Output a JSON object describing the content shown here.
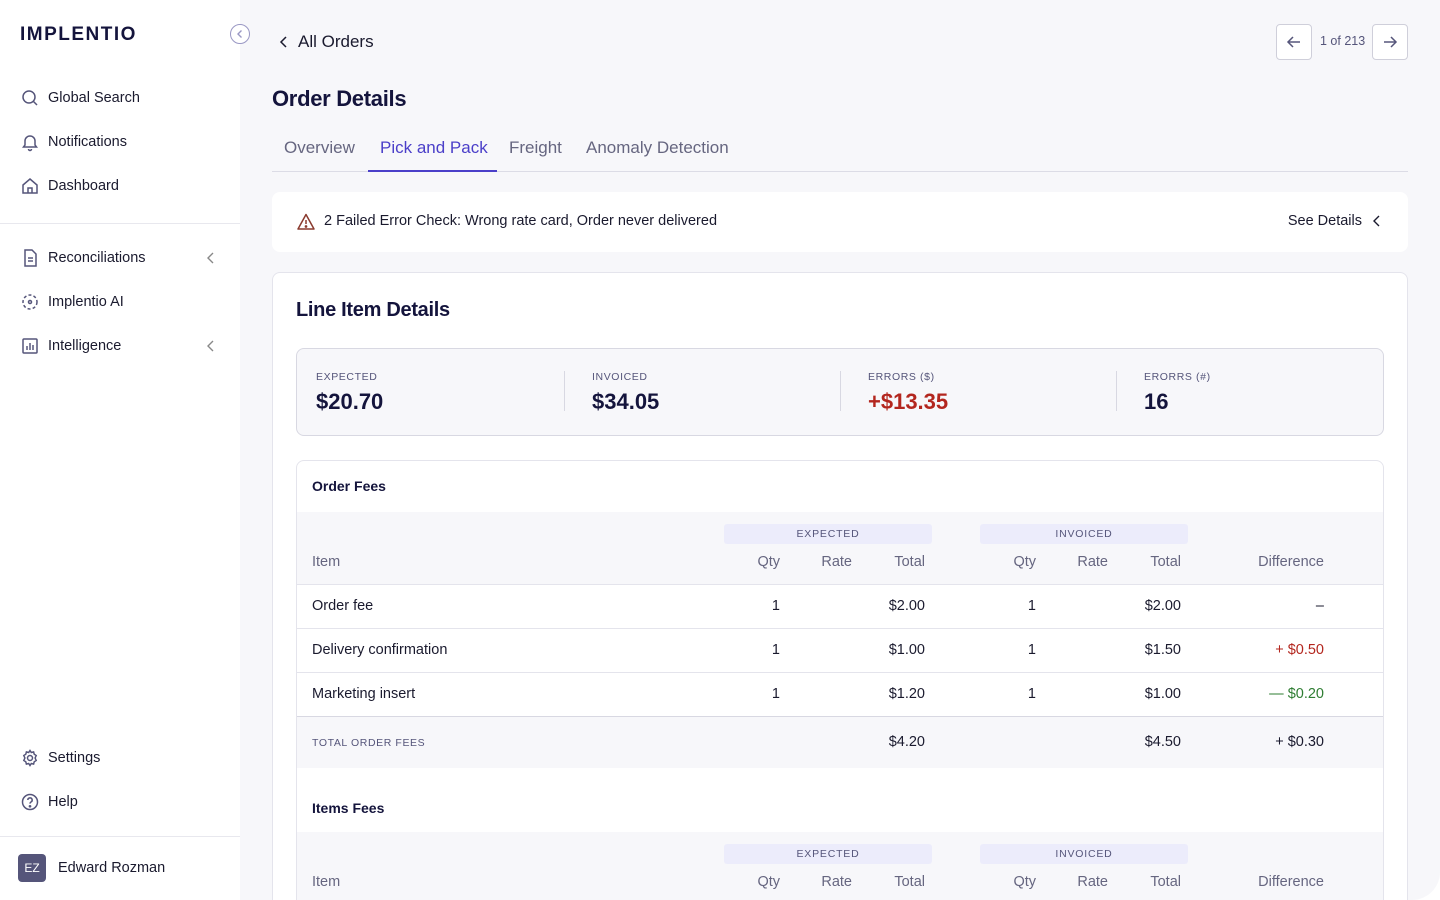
{
  "brand": {
    "logo": "IMPLENTIO"
  },
  "sidebar": {
    "items_top": [
      {
        "label": "Global Search",
        "icon": "search-icon"
      },
      {
        "label": "Notifications",
        "icon": "bell-icon"
      },
      {
        "label": "Dashboard",
        "icon": "home-icon"
      }
    ],
    "items_mid": [
      {
        "label": "Reconciliations",
        "icon": "document-icon"
      },
      {
        "label": "Implentio AI",
        "icon": "ai-icon"
      },
      {
        "label": "Intelligence",
        "icon": "chart-icon"
      }
    ],
    "items_bottom": [
      {
        "label": "Settings",
        "icon": "gear-icon"
      },
      {
        "label": "Help",
        "icon": "help-icon"
      }
    ],
    "user": {
      "initials": "EZ",
      "name": "Edward Rozman"
    }
  },
  "header": {
    "back_label": "All Orders",
    "pager": "1 of 213",
    "title": "Order Details"
  },
  "tabs": [
    {
      "label": "Overview"
    },
    {
      "label": "Pick and Pack"
    },
    {
      "label": "Freight"
    },
    {
      "label": "Anomaly Detection"
    }
  ],
  "alert": {
    "text": "2 Failed Error Check: Wrong rate card, Order never delivered",
    "action": "See Details"
  },
  "line_items": {
    "title": "Line Item Details",
    "summary": [
      {
        "label": "EXPECTED",
        "value": "$20.70"
      },
      {
        "label": "INVOICED",
        "value": "$34.05"
      },
      {
        "label": "ERRORS ($)",
        "value": "+$13.35"
      },
      {
        "label": "ERORRS (#)",
        "value": "16"
      }
    ]
  },
  "columns": {
    "expected_group": "EXPECTED",
    "invoiced_group": "INVOICED",
    "item": "Item",
    "qty": "Qty",
    "rate": "Rate",
    "total": "Total",
    "difference": "Difference"
  },
  "order_fees": {
    "title": "Order Fees",
    "rows": [
      {
        "item": "Order fee",
        "exp_qty": "1",
        "exp_total": "$2.00",
        "inv_qty": "1",
        "inv_total": "$2.00",
        "diff": "–"
      },
      {
        "item": "Delivery confirmation",
        "exp_qty": "1",
        "exp_total": "$1.00",
        "inv_qty": "1",
        "inv_total": "$1.50",
        "diff": "+ $0.50"
      },
      {
        "item": "Marketing insert",
        "exp_qty": "1",
        "exp_total": "$1.20",
        "inv_qty": "1",
        "inv_total": "$1.00",
        "diff": "— $0.20"
      }
    ],
    "total_label": "TOTAL ORDER FEES",
    "total_expected": "$4.20",
    "total_invoiced": "$4.50",
    "total_diff": "+ $0.30"
  },
  "items_fees": {
    "title": "Items Fees"
  },
  "colors": {
    "accent": "#4b3fc9",
    "error": "#b3261e",
    "success": "#2e7d32",
    "navy": "#14143c"
  }
}
